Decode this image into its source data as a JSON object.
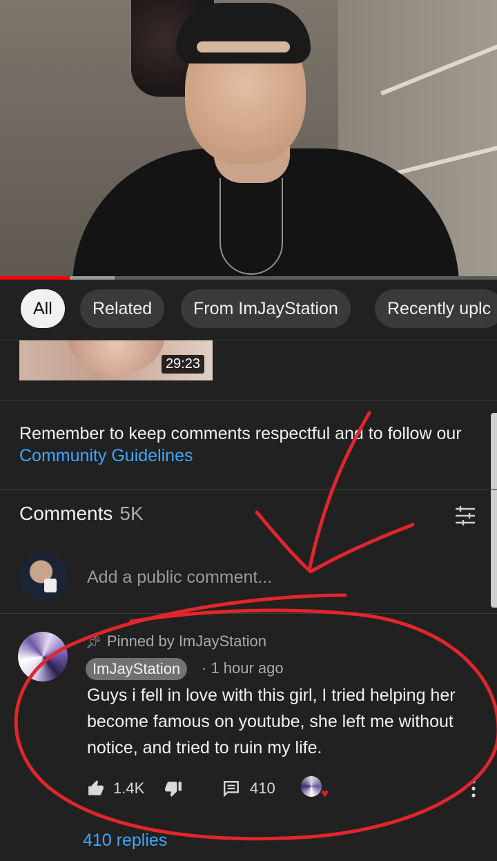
{
  "video": {
    "progress_fraction": 0.14,
    "buffered_fraction": 0.23
  },
  "chips": [
    "All",
    "Related",
    "From ImJayStation",
    "Recently uplc"
  ],
  "thumbnail": {
    "duration": "29:23"
  },
  "guidelines": {
    "text": "Remember to keep comments respectful and to follow our",
    "link": "Community Guidelines"
  },
  "comments": {
    "title": "Comments",
    "count": "5K",
    "add_placeholder": "Add a public comment..."
  },
  "pinned_comment": {
    "pinned_label": "Pinned by ImJayStation",
    "author": "ImJayStation",
    "time": "· 1 hour ago",
    "text": "Guys i fell in love with this girl, I tried helping her become famous on youtube, she left me without notice, and tried to ruin my life.",
    "likes": "1.4K",
    "reply_count": "410",
    "replies_link": "410 replies"
  },
  "icons": {
    "like": "thumbs-up-icon",
    "dislike": "thumbs-down-icon",
    "reply": "comment-icon",
    "more": "more-vert-icon",
    "sort": "sort-icon",
    "pin": "pin-icon",
    "heart": "creator-heart-icon"
  },
  "colors": {
    "background": "#212121",
    "progress": "#ff0000",
    "link": "#3ea6ff",
    "annotation": "#e0262c"
  }
}
